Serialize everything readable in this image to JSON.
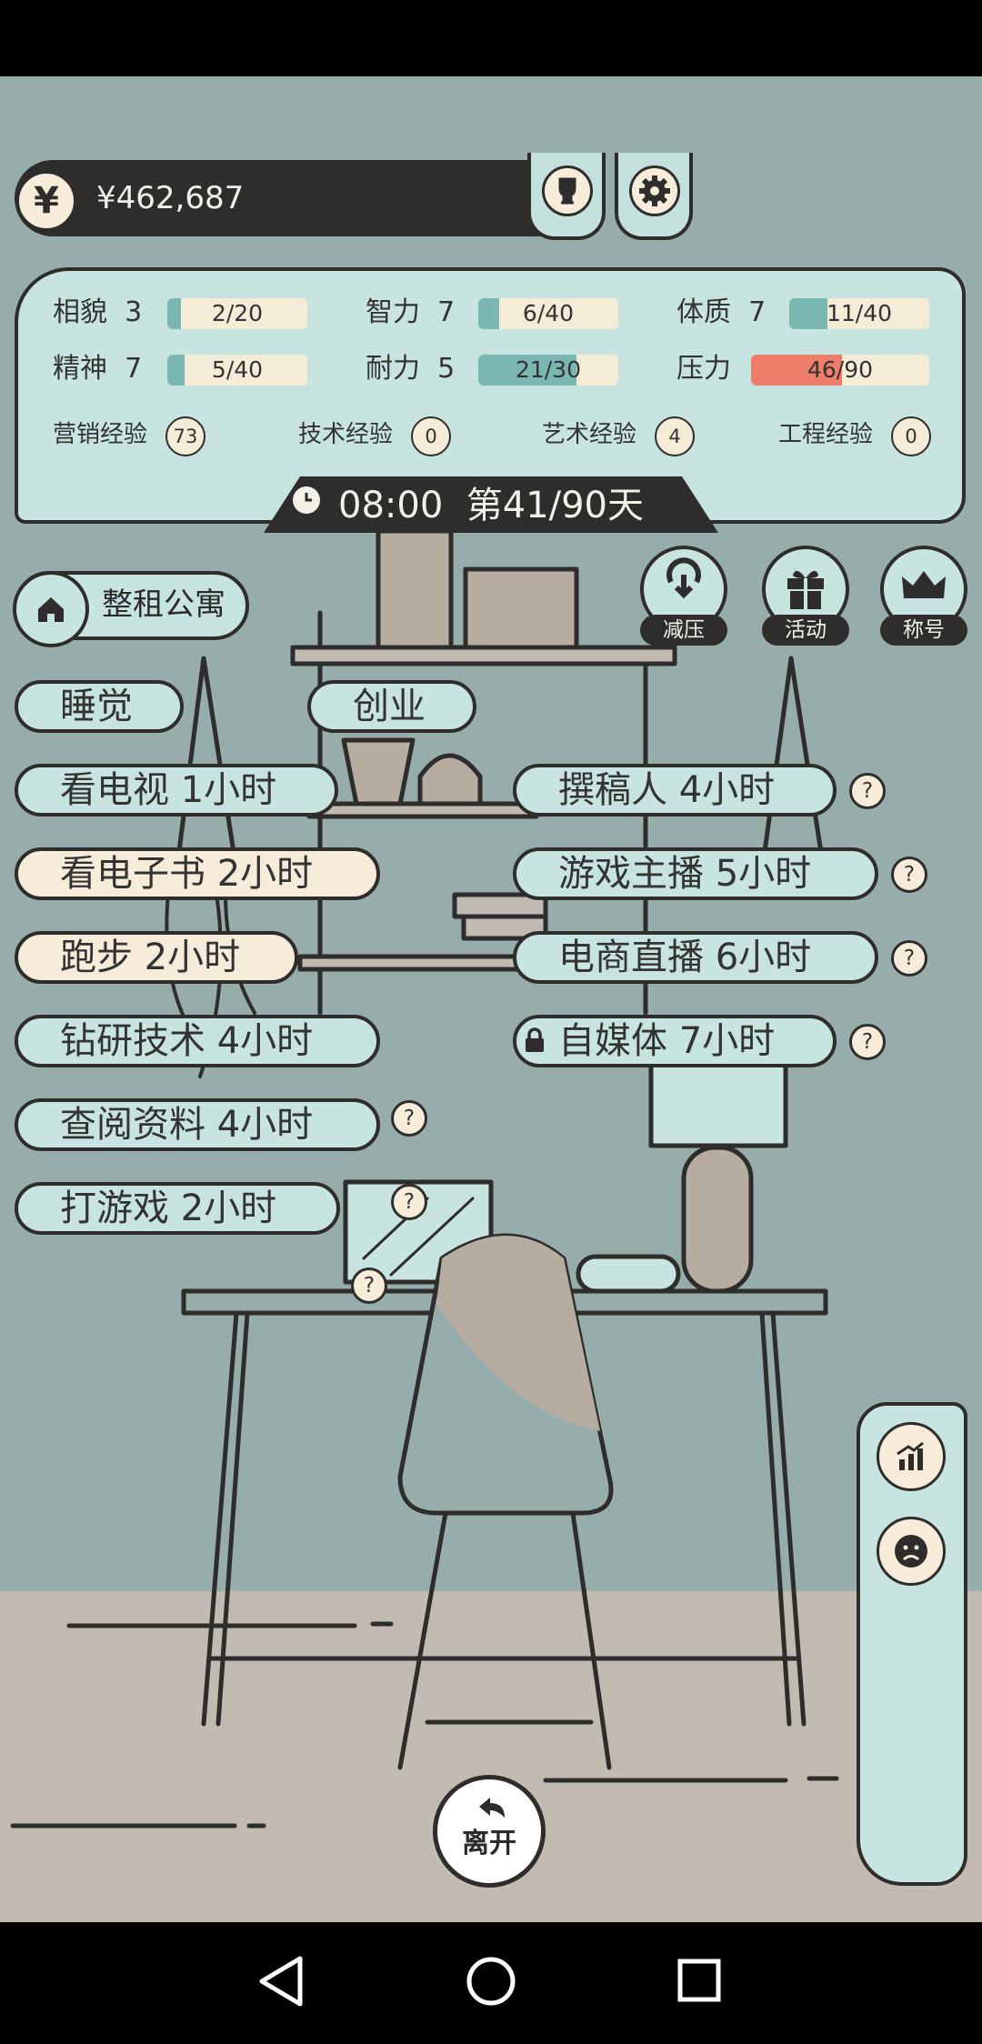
{
  "header": {
    "currency_symbol": "¥",
    "money": "¥462,687",
    "trophy_icon": "trophy-icon",
    "settings_icon": "gear-icon"
  },
  "stats": [
    {
      "label": "相貌  3",
      "value": "2/20",
      "fill": 0.1,
      "color": "#7ab7b1"
    },
    {
      "label": "智力  7",
      "value": "6/40",
      "fill": 0.15,
      "color": "#7ab7b1"
    },
    {
      "label": "体质  7",
      "value": "11/40",
      "fill": 0.275,
      "color": "#7ab7b1"
    },
    {
      "label": "精神  7",
      "value": "5/40",
      "fill": 0.125,
      "color": "#7ab7b1"
    },
    {
      "label": "耐力  5",
      "value": "21/30",
      "fill": 0.7,
      "color": "#7ab7b1"
    },
    {
      "label": "压力",
      "value": "46/90",
      "fill": 0.51,
      "color": "#ee7d6a"
    }
  ],
  "experience": [
    {
      "label": "营销经验",
      "value": "73"
    },
    {
      "label": "技术经验",
      "value": "0"
    },
    {
      "label": "艺术经验",
      "value": "4"
    },
    {
      "label": "工程经验",
      "value": "0"
    }
  ],
  "time": {
    "clock": "08:00",
    "day": "第41/90天"
  },
  "location": {
    "label": "整租公寓",
    "icon": "home-icon"
  },
  "round_buttons": [
    {
      "label": "减压",
      "icon": "stress-relief-icon"
    },
    {
      "label": "活动",
      "icon": "gift-icon"
    },
    {
      "label": "称号",
      "icon": "crown-icon"
    }
  ],
  "actions_left": [
    {
      "label": "睡觉"
    },
    {
      "label": "看电视 1小时"
    },
    {
      "label": "看电子书 2小时"
    },
    {
      "label": "跑步 2小时"
    },
    {
      "label": "钻研技术 4小时"
    },
    {
      "label": "查阅资料 4小时"
    },
    {
      "label": "打游戏 2小时"
    }
  ],
  "actions_right": [
    {
      "label": "创业"
    },
    {
      "label": "撰稿人 4小时"
    },
    {
      "label": "游戏主播 5小时"
    },
    {
      "label": "电商直播 6小时"
    },
    {
      "label": "自媒体 7小时",
      "locked": true
    }
  ],
  "help_symbol": "?",
  "side_panel": [
    {
      "icon": "chart-icon"
    },
    {
      "icon": "sad-face-icon"
    }
  ],
  "leave": {
    "label": "离开",
    "icon": "back-arrow-icon"
  },
  "navbar": {
    "back": "back-triangle-icon",
    "home": "home-circle-icon",
    "recents": "recents-square-icon"
  }
}
